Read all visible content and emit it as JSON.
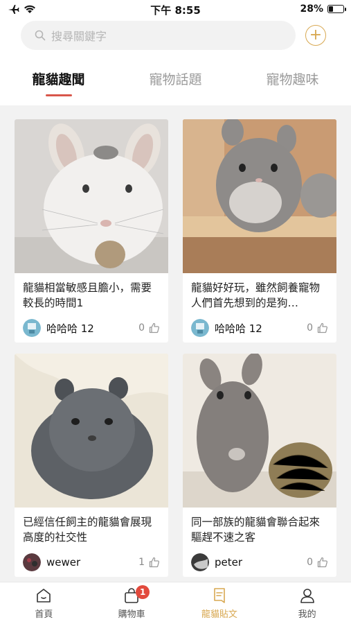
{
  "status_bar": {
    "time": "下午 8:55",
    "battery_percent": "28%",
    "battery_level": 0.28
  },
  "search": {
    "placeholder": "搜尋關鍵字"
  },
  "tabs": [
    {
      "label": "龍貓趣聞",
      "active": true
    },
    {
      "label": "寵物話題",
      "active": false
    },
    {
      "label": "寵物趣味",
      "active": false
    }
  ],
  "posts": [
    {
      "title": "龍貓相當敏感且膽小，需要較長的時間1",
      "author": "哈哈哈 12",
      "likes": "0"
    },
    {
      "title": "龍貓好好玩，雖然飼養寵物人們首先想到的是狗…",
      "author": "哈哈哈 12",
      "likes": "0"
    },
    {
      "title": "已經信任飼主的龍貓會展現高度的社交性",
      "author": "wewer",
      "likes": "1"
    },
    {
      "title": "同一部族的龍貓會聯合起來驅趕不速之客",
      "author": "peter",
      "likes": "0"
    }
  ],
  "nav": {
    "items": [
      {
        "label": "首頁",
        "icon": "home-icon",
        "active": false
      },
      {
        "label": "購物車",
        "icon": "cart-icon",
        "active": false,
        "badge": "1"
      },
      {
        "label": "龍貓貼文",
        "icon": "post-icon",
        "active": true
      },
      {
        "label": "我的",
        "icon": "user-icon",
        "active": false
      }
    ]
  },
  "colors": {
    "accent": "#d8a851",
    "tab_underline": "#d8574b",
    "badge": "#e24a3d",
    "content_bg": "#f2f2f2"
  }
}
